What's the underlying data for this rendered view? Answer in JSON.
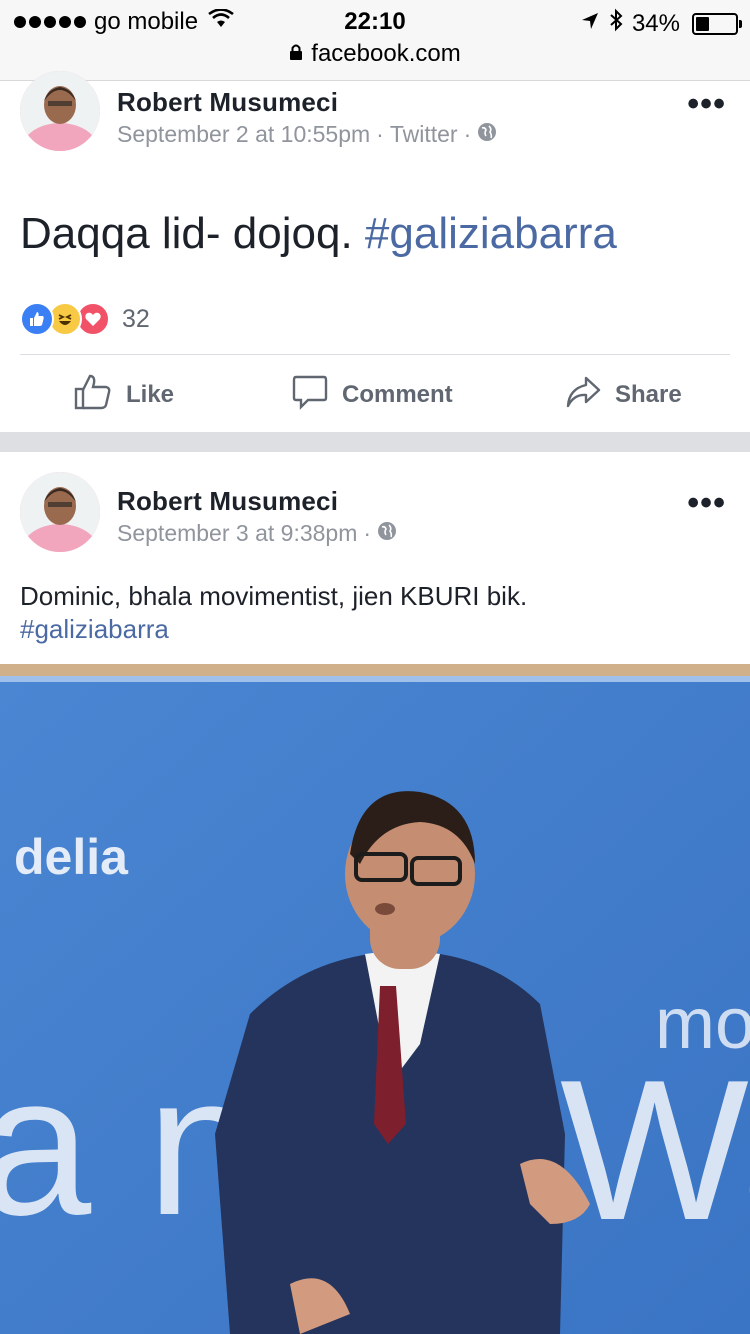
{
  "status_bar": {
    "carrier": "go mobile",
    "time": "22:10",
    "battery_percent": "34%",
    "battery_level": 0.34,
    "url": "facebook.com"
  },
  "posts": [
    {
      "author": "Robert Musumeci",
      "date": "September 2 at 10:55pm",
      "source": "Twitter",
      "text": "Daqqa lid- dojoq.",
      "hashtag": "#galiziabarra",
      "reaction_count": "32"
    },
    {
      "author": "Robert Musumeci",
      "date": "September 3 at 9:38pm",
      "text": "Dominic, bhala movimentist, jien KBURI bik.",
      "hashtag": "#galiziabarra",
      "photo_text": {
        "top_left": "delia",
        "right_small": "mo",
        "left_large": "a n",
        "right_large": "Wa"
      }
    }
  ],
  "actions": {
    "like": "Like",
    "comment": "Comment",
    "share": "Share"
  },
  "colors": {
    "link": "#4b6aa3",
    "meta": "#90949c",
    "like_blue": "#3b7ff5",
    "love_red": "#f25268",
    "haha_yellow": "#f7c944",
    "photo_bg": "#3f7fcf"
  }
}
